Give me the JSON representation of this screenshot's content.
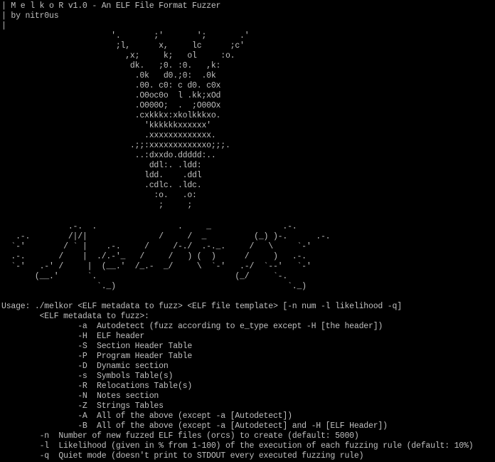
{
  "terminal": {
    "bg_color": "#000000",
    "fg_color": "#c0c0c0",
    "lines": [
      "| M e l k o R v1.0 - An ELF File Format Fuzzer",
      "| by nitr0us",
      "|",
      "                       '.       ;'       ';       .'",
      "                        ;l,      x,     lc      ;c'",
      "                          ,x;     k;   ol     :o.",
      "                           dk.   ;0. :0.   ,k:",
      "                            .0k   d0.;0:  .0k",
      "                            .00. c0: c d0. c0x",
      "                            .O0oc0o  l .kk;xOd",
      "                            .O000O;  .  ;O00Ox",
      "                            .cxkkkx:xkolkkkxo.",
      "                              'kkkkkkxxxxxx'",
      "                              .xxxxxxxxxxxxx.",
      "                           .;;:xxxxxxxxxxxxo;;;.",
      "                            ..:dxxdo.ddddd:..",
      "                               ddl:. .ldd:",
      "                              ldd.    .ddl",
      "                              .cdlc. .ldc.",
      "                                :o.   .o:",
      "                                 ;     ;",
      "",
      "",
      "              .-.  .                 .     _               .-.",
      "   .-.        /|/|               /     /  _          (_) )-.      .-.",
      "  `-'        / ` |    .-.     /     /-./  .-._.     /   \\     `-'",
      "  .-.       /    |  ./.-'_   /     /   ) (  )      /     )   .-.",
      "  `-'   .-' /     |  (__.'  /_.-  _/     \\  `-'   .-/  `--'   `-'",
      "       (__.'      `.                             (_/     `-.",
      "                    `._)                                    `._)",
      "",
      "Usage: ./melkor <ELF metadata to fuzz> <ELF file template> [-n num -l likelihood -q]",
      "        <ELF metadata to fuzz>:",
      "                -a  Autodetect (fuzz according to e_type except -H [the header])",
      "                -H  ELF header",
      "                -S  Section Header Table",
      "                -P  Program Header Table",
      "                -D  Dynamic section",
      "                -s  Symbols Table(s)",
      "                -R  Relocations Table(s)",
      "                -N  Notes section",
      "                -Z  Strings Tables",
      "                -A  All of the above (except -a [Autodetect])",
      "                -B  All of the above (except -a [Autodetect] and -H [ELF Header])",
      "        -n  Number of new fuzzed ELF files (orcs) to create (default: 5000)",
      "        -l  Likelihood (given in % from 1-100) of the execution of each fuzzing rule (default: 10%)",
      "        -q  Quiet mode (doesn't print to STDOUT every executed fuzzing rule)"
    ]
  }
}
